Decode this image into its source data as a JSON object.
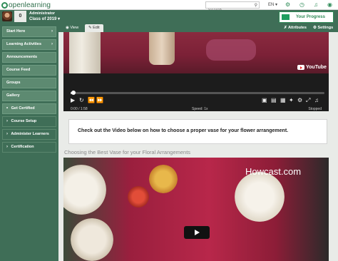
{
  "brand": {
    "name": "openlearning"
  },
  "topbar": {
    "search_placeholder": "Search",
    "language": "EN",
    "icons": [
      "search-icon",
      "chevron-down-icon",
      "gear-icon",
      "clock-icon",
      "bell-icon",
      "help-icon"
    ]
  },
  "header": {
    "counter": "0",
    "user_role": "Administrator",
    "class_name": "Class of 2019",
    "progress_label": "Your Progress",
    "accent_color": "#1f9d5f"
  },
  "sidebar": {
    "items": [
      {
        "label": "Start Here",
        "chevron": true
      },
      {
        "label": "Learning Activities",
        "chevron": true
      },
      {
        "label": "Announcements",
        "chevron": false
      },
      {
        "label": "Course Feed",
        "chevron": false
      },
      {
        "label": "Groups",
        "chevron": false
      },
      {
        "label": "Gallery",
        "chevron": false
      },
      {
        "label": "Get Certified",
        "prefix": "•"
      },
      {
        "label": "Course Setup",
        "prefix": "›"
      },
      {
        "label": "Administer Learners",
        "prefix": "›"
      },
      {
        "label": "Certification",
        "prefix": "›"
      }
    ]
  },
  "tabs": {
    "view": "View",
    "edit": "Edit",
    "attributes": "Attributes",
    "settings": "Settings"
  },
  "video1": {
    "brand": "YouTube",
    "time": "0:00 / 1:58",
    "speed": "Speed: 1x",
    "status": "Stopped",
    "progress": 0.01
  },
  "main": {
    "callout": "Check out the Video below on how to choose a proper vase for your flower arrangement.",
    "video_title": "Choosing the Best Vase for your Floral Arrangements"
  },
  "video2": {
    "brand": "Howcast.com"
  }
}
